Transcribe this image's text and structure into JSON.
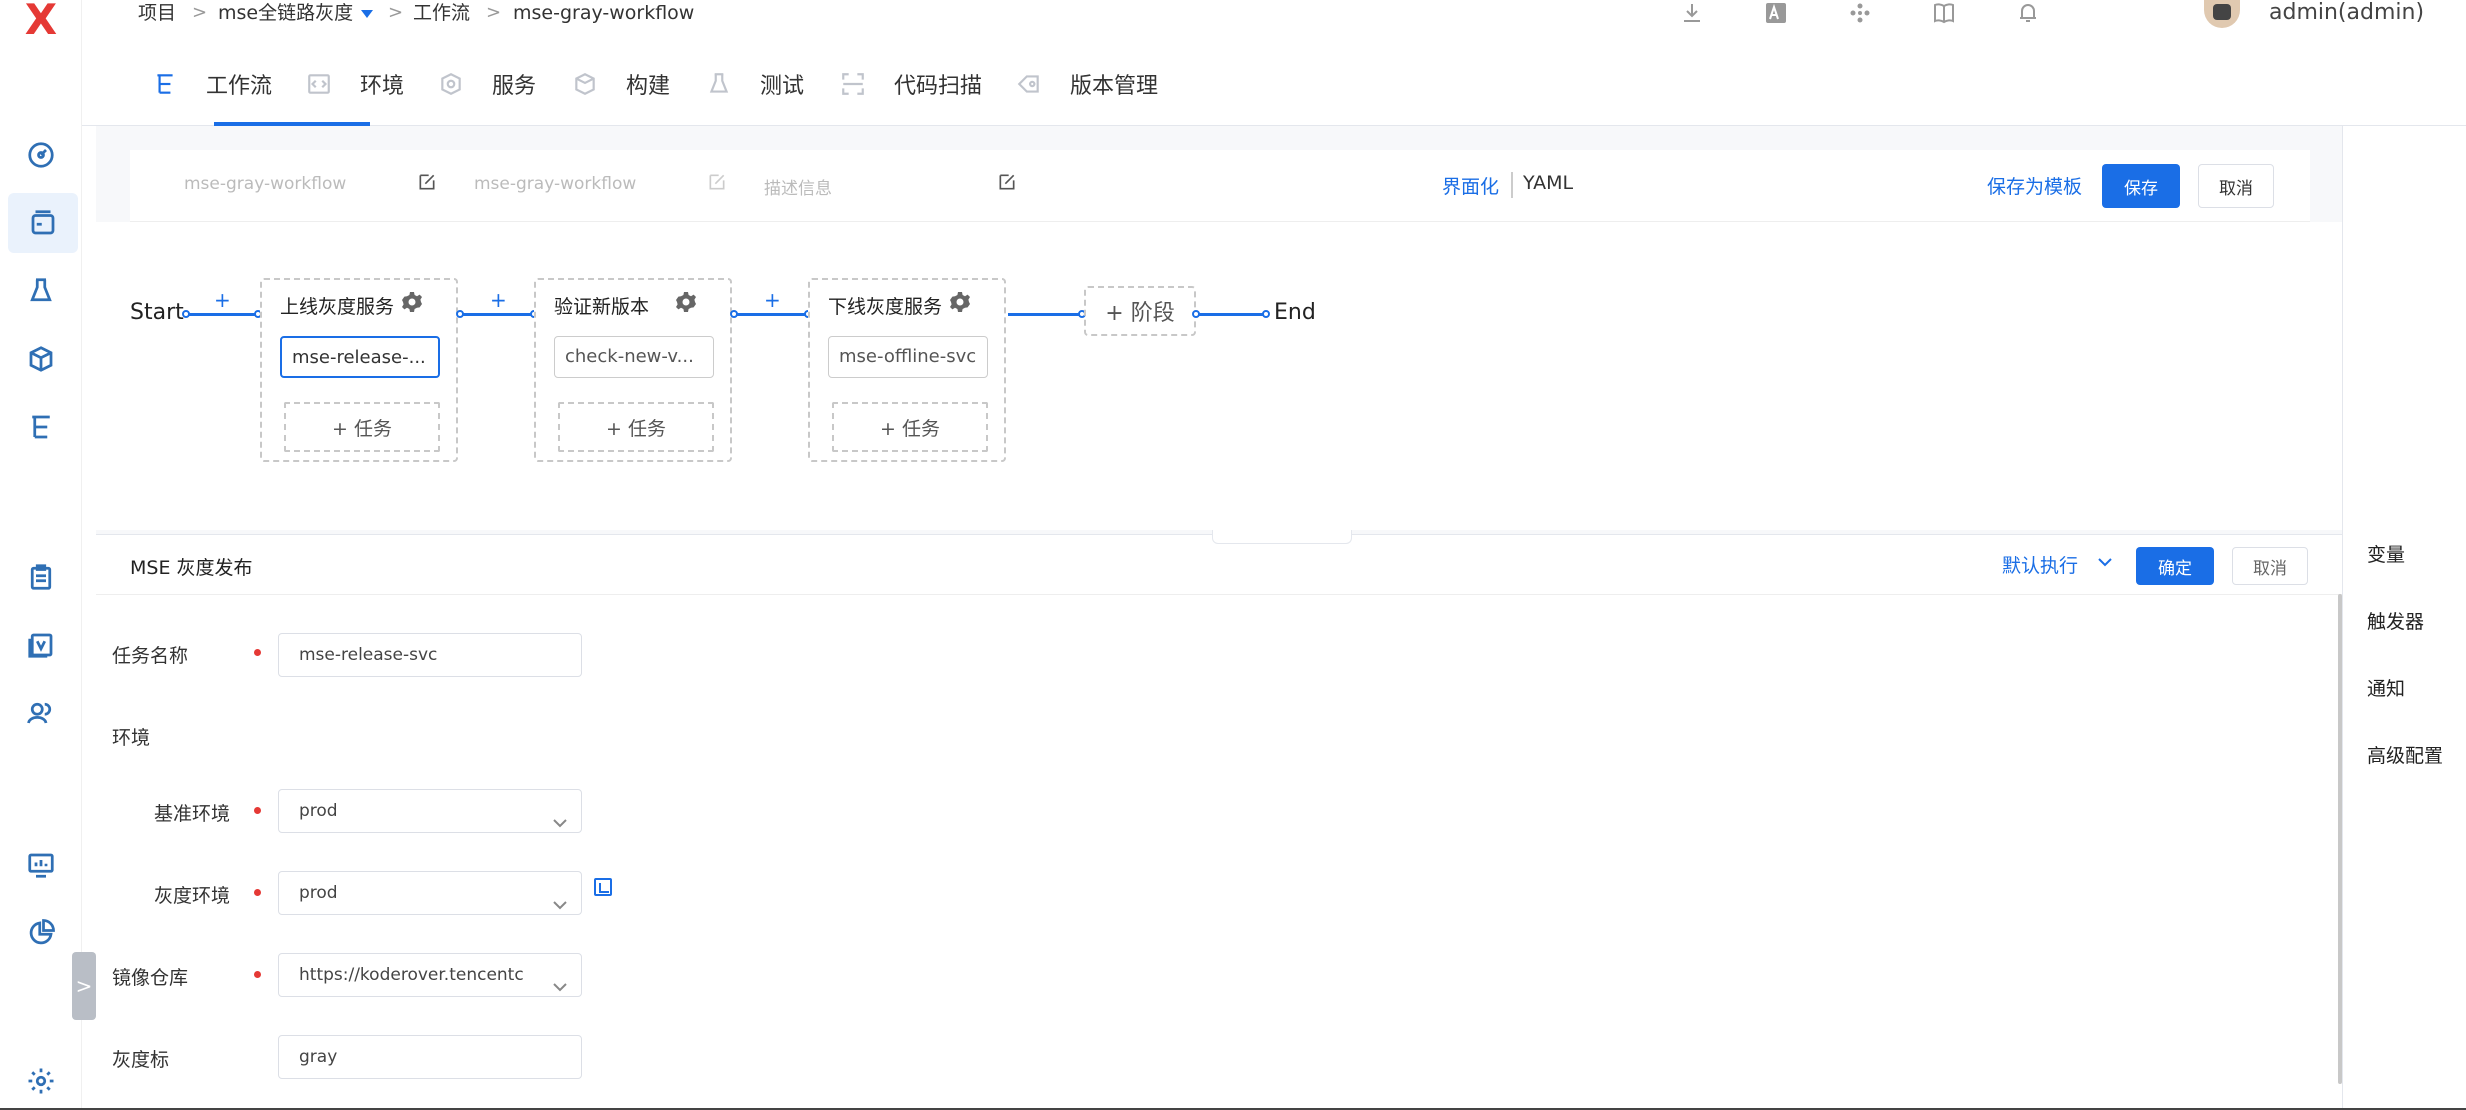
{
  "app": {
    "logo_text": "X",
    "logo_color": "#e53935",
    "accent_color": "#1a6ee6"
  },
  "breadcrumb": {
    "project": "项目",
    "project_name": "mse全链路灰度",
    "section": "工作流",
    "workflow": "mse-gray-workflow",
    "separator": ">"
  },
  "header": {
    "user": "admin(admin)",
    "icons": [
      "download-icon",
      "translate-icon",
      "apps-icon",
      "book-icon",
      "bell-icon"
    ]
  },
  "sidebar": {
    "icons": [
      "dashboard-icon",
      "project-icon",
      "flask-icon",
      "package-icon",
      "workflow-icon",
      "clipboard-icon",
      "version-icon",
      "users-icon",
      "monitor-icon",
      "pie-chart-icon",
      "settings-icon"
    ],
    "expand_glyph": ">"
  },
  "tabs": [
    {
      "label": "工作流",
      "icon": "workflow-icon",
      "active": true
    },
    {
      "label": "环境",
      "icon": "code-icon",
      "active": false
    },
    {
      "label": "服务",
      "icon": "cube-network-icon",
      "active": false
    },
    {
      "label": "构建",
      "icon": "box-icon",
      "active": false
    },
    {
      "label": "测试",
      "icon": "flask-icon",
      "active": false
    },
    {
      "label": "代码扫描",
      "icon": "scan-icon",
      "active": false
    },
    {
      "label": "版本管理",
      "icon": "tag-icon",
      "active": false
    }
  ],
  "editor": {
    "name_placeholder": "mse-gray-workflow",
    "display_name_placeholder": "mse-gray-workflow",
    "description_placeholder": "描述信息",
    "mode_ui": "界面化",
    "mode_yaml": "YAML",
    "save_template": "保存为模板",
    "save": "保存",
    "cancel": "取消"
  },
  "pipeline": {
    "start": "Start",
    "end": "End",
    "plus": "+",
    "add_stage": "+ 阶段",
    "add_job": "+ 任务",
    "stages": [
      {
        "name": "上线灰度服务",
        "job": "mse-release-...",
        "active": true
      },
      {
        "name": "验证新版本",
        "job": "check-new-v...",
        "active": false
      },
      {
        "name": "下线灰度服务",
        "job": "mse-offline-svc",
        "active": false
      }
    ]
  },
  "right_panel": {
    "items": [
      "变量",
      "触发器",
      "通知",
      "高级配置"
    ]
  },
  "task": {
    "title": "MSE 灰度发布",
    "exec_mode": "默认执行",
    "confirm": "确定",
    "cancel": "取消",
    "fields": {
      "task_name": {
        "label": "任务名称",
        "value": "mse-release-svc"
      },
      "env_group": {
        "label": "环境"
      },
      "base_env": {
        "label": "基准环境",
        "value": "prod"
      },
      "gray_env": {
        "label": "灰度环境",
        "value": "prod"
      },
      "image_repo": {
        "label": "镜像仓库",
        "value": "https://koderover.tencentc"
      },
      "gray_tag": {
        "label": "灰度标",
        "value": "gray"
      }
    }
  }
}
